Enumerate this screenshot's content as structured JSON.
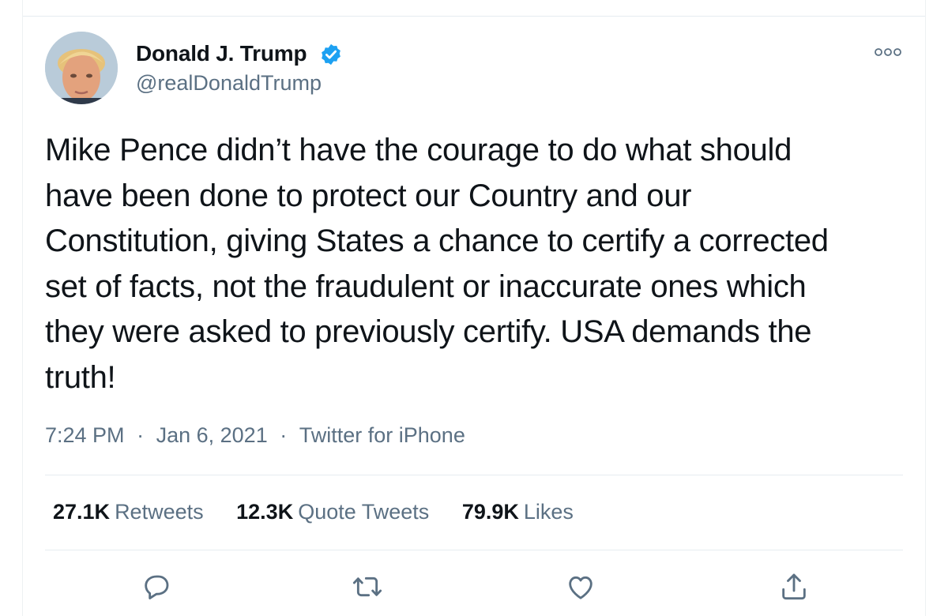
{
  "author": {
    "name": "Donald J. Trump",
    "handle": "@realDonaldTrump",
    "verified_color": "#1da1f2",
    "avatar_icon": "profile-photo"
  },
  "tweet": {
    "text": "Mike Pence didn’t have the courage to do what should\nhave been done to protect our Country and our\nConstitution, giving States a chance to certify a corrected\nset of facts, not the fraudulent or inaccurate ones which\nthey were asked to previously certify. USA demands the\ntruth!"
  },
  "meta": {
    "time": "7:24 PM",
    "date": "Jan 6, 2021",
    "source": "Twitter for iPhone",
    "separator": "·"
  },
  "stats": [
    {
      "value": "27.1K",
      "label": "Retweets"
    },
    {
      "value": "12.3K",
      "label": "Quote Tweets"
    },
    {
      "value": "79.9K",
      "label": "Likes"
    }
  ],
  "actions": [
    {
      "icon": "reply-icon"
    },
    {
      "icon": "retweet-icon"
    },
    {
      "icon": "like-icon"
    },
    {
      "icon": "share-icon"
    }
  ],
  "colors": {
    "text_primary": "#0f1419",
    "text_secondary": "#5b7083",
    "divider": "#e6ecf0",
    "icon": "#5b7083"
  }
}
